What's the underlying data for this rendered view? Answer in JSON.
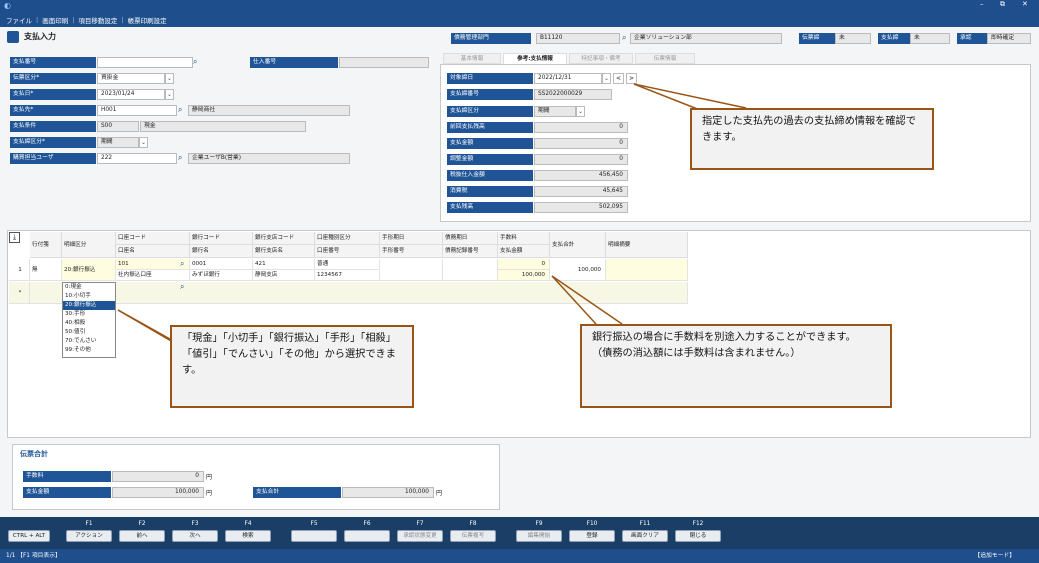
{
  "window": {
    "min": "–",
    "restore": "⧉",
    "close": "✕"
  },
  "menu": [
    "ファイル",
    "画面印刷",
    "項目移動設定",
    "帳票印刷設定"
  ],
  "page": {
    "title": "支払入力"
  },
  "header": {
    "dept_label": "債務管理部門",
    "dept_code": "B11120",
    "dept_name": "企業ソリューション部",
    "slip_label": "伝票締",
    "slip_val": "未",
    "pay_label": "支払締",
    "pay_val": "未",
    "approve_label": "承認",
    "approve_val": "即時確定"
  },
  "form": {
    "pay_no": "支払番号",
    "pay_no_val": "",
    "purch_no": "仕入番号",
    "slip_type": "伝票区分*",
    "slip_type_val": "買掛金",
    "pay_date": "支払日*",
    "pay_date_val": "2023/01/24",
    "payee": "支払先*",
    "payee_code": "H001",
    "payee_name": "静岡商社",
    "pay_cond": "支払条件",
    "pay_cond_code": "S00",
    "pay_cond_name": "現金",
    "close_type": "支払締区分*",
    "close_type_val": "期間",
    "buyer": "購買担当ユーザ",
    "buyer_code": "222",
    "buyer_name": "企業ユーザB(営業)"
  },
  "tabs": [
    "基本情報",
    "参考:支払情報",
    "特記事項・備考",
    "伝票情報"
  ],
  "ref": {
    "close_date": "対象締日",
    "close_date_val": "2022/12/31",
    "prev": "<",
    "next": ">",
    "close_no": "支払締番号",
    "close_no_val": "SS2022000029",
    "close_kind": "支払締区分",
    "close_kind_val": "期間",
    "rows": [
      [
        "前回支払残高",
        "0"
      ],
      [
        "支払金額",
        "0"
      ],
      [
        "調整金額",
        "0"
      ],
      [
        "税抜仕入金額",
        "456,450"
      ],
      [
        "消費税",
        "45,645"
      ],
      [
        "支払残高",
        "502,095"
      ]
    ]
  },
  "grid": {
    "h1": [
      "行付箋",
      "明細区分",
      "口座コード",
      "銀行コード",
      "銀行支店コード",
      "口座種別区分",
      "手形期日",
      "債務期日",
      "手数料",
      "支払合計",
      "明細摘要"
    ],
    "h2": [
      "",
      "",
      "口座名",
      "銀行名",
      "銀行支店名",
      "口座番号",
      "手形番号",
      "債務記録番号",
      "支払金額",
      "",
      ""
    ],
    "row_no": "1",
    "tag": "無",
    "kind": "20:銀行振込",
    "acct_code": "101",
    "acct_name": "社内振込口座",
    "bank_code": "0001",
    "bank_name": "みずほ銀行",
    "branch_code": "421",
    "branch_name": "静岡支店",
    "acct_type": "普通",
    "acct_num": "1234567",
    "fee": "0",
    "amount": "100,000",
    "total": "100,000",
    "new_mark": "*"
  },
  "dropdown": [
    "0:現金",
    "10:小切手",
    "20:銀行振込",
    "30:手形",
    "40:相殺",
    "50:値引",
    "70:でんさい",
    "99:その他"
  ],
  "callouts": {
    "c1": "指定した支払先の過去の支払締め情報を確認できます。",
    "c2": "「現金」「小切手」「銀行振込」「手形」「相殺」「値引」「でんさい」「その他」から選択できます。",
    "c3a": "銀行振込の場合に手数料を別途入力することができます。",
    "c3b": "（債務の消込額には手数料は含まれません。）"
  },
  "totals": {
    "title": "伝票合計",
    "fee": "手数料",
    "fee_val": "0",
    "yen": "円",
    "pay": "支払金額",
    "pay_val": "100,000",
    "sum": "支払合計",
    "sum_val": "100,000"
  },
  "fkeys": [
    [
      "",
      "CTRL + ALT"
    ],
    [
      "F1",
      "アクション"
    ],
    [
      "F2",
      "前へ"
    ],
    [
      "F3",
      "次へ"
    ],
    [
      "F4",
      "検索"
    ],
    [
      "F5",
      ""
    ],
    [
      "F6",
      ""
    ],
    [
      "F7",
      "承認状態変更"
    ],
    [
      "F8",
      "伝票複写"
    ],
    [
      "F9",
      "編集開始"
    ],
    [
      "F10",
      "登録"
    ],
    [
      "F11",
      "画面クリア"
    ],
    [
      "F12",
      "閉じる"
    ]
  ],
  "status": {
    "left": "1/1 【F1 項目表示】",
    "right": "【追加モード】"
  }
}
